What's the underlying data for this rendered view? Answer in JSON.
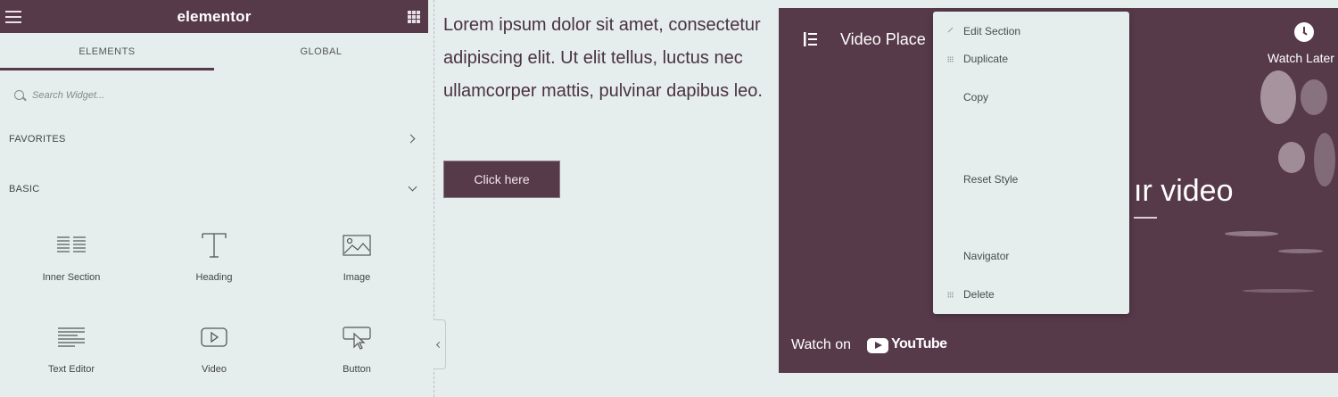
{
  "panel": {
    "logo": "elementor",
    "tabs": [
      {
        "label": "ELEMENTS",
        "active": true
      },
      {
        "label": "GLOBAL",
        "active": false
      }
    ],
    "search": {
      "placeholder": "Search Widget...",
      "value": ""
    },
    "categories": [
      {
        "label": "FAVORITES",
        "expanded": false
      },
      {
        "label": "BASIC",
        "expanded": true
      }
    ],
    "widgets": [
      {
        "label": "Inner Section",
        "icon": "inner-section-icon"
      },
      {
        "label": "Heading",
        "icon": "heading-icon"
      },
      {
        "label": "Image",
        "icon": "image-icon"
      },
      {
        "label": "Text Editor",
        "icon": "text-editor-icon"
      },
      {
        "label": "Video",
        "icon": "video-icon"
      },
      {
        "label": "Button",
        "icon": "button-icon"
      }
    ]
  },
  "content": {
    "lorem": "Lorem ipsum dolor sit amet, consectetur adipiscing elit. Ut elit tellus, luctus nec ullamcorper mattis, pulvinar dapibus leo.",
    "button_label": "Click here"
  },
  "video": {
    "title": "Video Place",
    "watch_later": "Watch Later",
    "big_text": "ır video",
    "watch_on": "Watch on",
    "youtube": "YouTube"
  },
  "context_menu": {
    "items": [
      {
        "label": "Edit Section",
        "icon": "pencil-icon"
      },
      {
        "label": "Duplicate",
        "icon": "duplicate-icon"
      },
      {
        "label": "Copy",
        "icon": ""
      },
      {
        "label": "Reset Style",
        "icon": ""
      },
      {
        "label": "Navigator",
        "icon": ""
      },
      {
        "label": "Delete",
        "icon": "trash-icon"
      }
    ]
  },
  "colors": {
    "accent": "#573a4a",
    "background": "#e5eeed",
    "text": "#4a3240"
  }
}
